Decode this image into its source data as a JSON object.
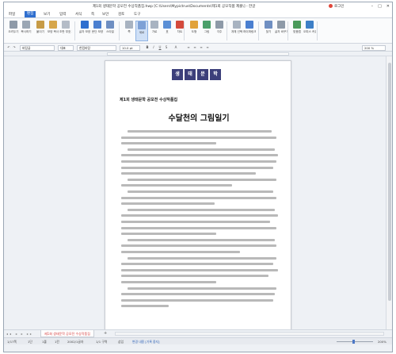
{
  "window": {
    "title": "제1회 생태문학 공모전 수상작품집.hwp [C:\\Users\\Mypictrue\\Documents\\제1회 공모작품 제출\\] - 한글",
    "login": "로그인"
  },
  "menu": {
    "items": [
      "파일",
      "편집",
      "보기",
      "입력",
      "서식",
      "쪽",
      "보안",
      "검토",
      "도구"
    ],
    "active_index": 1
  },
  "ribbon": {
    "buttons": [
      {
        "label": "오려두기",
        "icon": "scissors-icon",
        "color": "#8e9aa8"
      },
      {
        "label": "복사하기",
        "icon": "copy-icon",
        "color": "#9aa6b4"
      },
      {
        "label": "붙이기",
        "icon": "paste-icon",
        "color": "#c79b46"
      },
      {
        "label": "모양 복사",
        "icon": "format-painter-icon",
        "color": "#d6a64a"
      },
      {
        "label": "조판 부호 지우기",
        "icon": "clear-marks-icon",
        "color": "#b4bcc7"
      },
      {
        "label": "글자 모양",
        "icon": "char-shape-icon",
        "color": "#2f6fcf"
      },
      {
        "label": "문단 모양",
        "icon": "para-shape-icon",
        "color": "#4a7fd0"
      },
      {
        "label": "스타일",
        "icon": "style-icon",
        "color": "#6f8fc2"
      },
      {
        "label": "쪽",
        "icon": "page-icon",
        "color": "#a8b3c1"
      },
      {
        "label": "세로",
        "icon": "vertical-icon",
        "color": "#7ea1d6"
      },
      {
        "label": "가로",
        "icon": "horizontal-icon",
        "color": "#a8b3c1"
      },
      {
        "label": "표",
        "icon": "table-icon",
        "color": "#5a8fd6"
      },
      {
        "label": "차트",
        "icon": "chart-icon",
        "color": "#d44a3c"
      },
      {
        "label": "도형",
        "icon": "shape-icon",
        "color": "#e1a23a"
      },
      {
        "label": "그림",
        "icon": "picture-icon",
        "color": "#4aa06a"
      },
      {
        "label": "각주",
        "icon": "footnote-icon",
        "color": "#8e9aa8"
      },
      {
        "label": "개체 선택",
        "icon": "select-object-icon",
        "color": "#a8b3c1"
      },
      {
        "label": "하이퍼링크",
        "icon": "link-icon",
        "color": "#4a7fd0"
      },
      {
        "label": "찾기",
        "icon": "find-icon",
        "color": "#6f8fc2"
      },
      {
        "label": "글자 바꾸기",
        "icon": "replace-icon",
        "color": "#8e9aa8"
      },
      {
        "label": "맞춤법",
        "icon": "spellcheck-icon",
        "color": "#4a9a5a"
      },
      {
        "label": "오피스 커뮤니케이션",
        "icon": "office-comm-icon",
        "color": "#3d7fc7"
      }
    ],
    "selected_index": 9
  },
  "format_toolbar": {
    "style": "바탕글",
    "font_lang": "대표",
    "font": "한컴바탕",
    "size": "10.0 pt",
    "zoom": "200 %"
  },
  "document": {
    "logo_chars": [
      "생",
      "태",
      "문",
      "학"
    ],
    "subtitle": "제1회 생태문학 공모전 수상작품집",
    "title": "수달천의 그림일기"
  },
  "tabs": {
    "doc_tab": "제1회 생태문학 공모전 수상작품집",
    "add_label": "+"
  },
  "status": {
    "page": "1/17쪽",
    "section": "1단",
    "line": "1줄",
    "column": "1칸",
    "chars": "2002/1글자",
    "section_no": "1/1 구역",
    "insert": "삽입",
    "track": "변경 내용 [기록 중지]",
    "zoom": "200%"
  }
}
